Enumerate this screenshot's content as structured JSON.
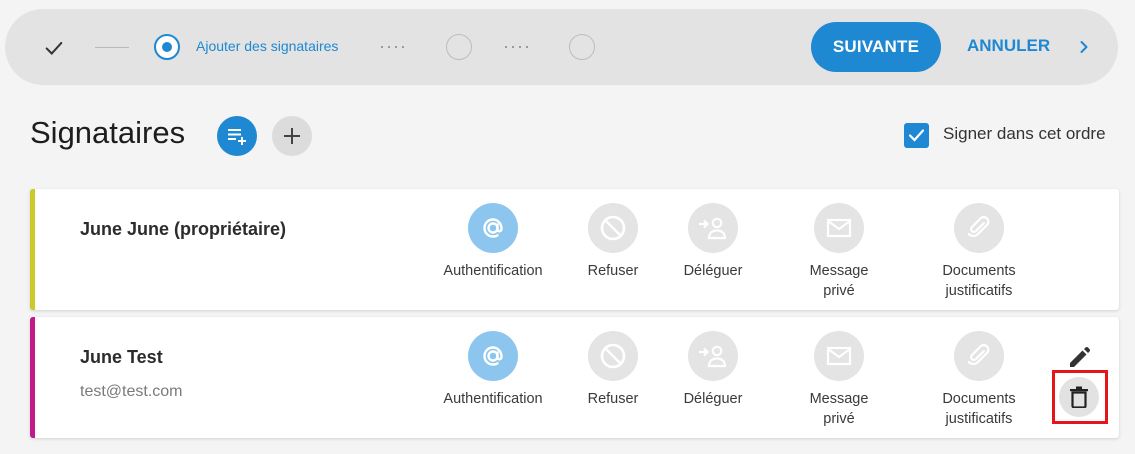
{
  "stepper": {
    "current_step_label": "Ajouter des signataires",
    "next_label": "SUIVANTE",
    "cancel_label": "ANNULER"
  },
  "header": {
    "title": "Signataires",
    "sign_in_order_label": "Signer dans cet ordre",
    "sign_in_order_checked": true
  },
  "options": {
    "authentication": "Authentification",
    "refuse": "Refuser",
    "delegate": "Déléguer",
    "private_message_line1": "Message",
    "private_message_line2": "privé",
    "supporting_docs_line1": "Documents",
    "supporting_docs_line2": "justificatifs"
  },
  "signers": [
    {
      "name": "June June (propriétaire)",
      "email": "",
      "color": "#c8cb2a"
    },
    {
      "name": "June Test",
      "email": "test@test.com",
      "color": "#c1198a"
    }
  ],
  "colors": {
    "accent": "#1e88d3",
    "highlight": "#e5151a"
  }
}
